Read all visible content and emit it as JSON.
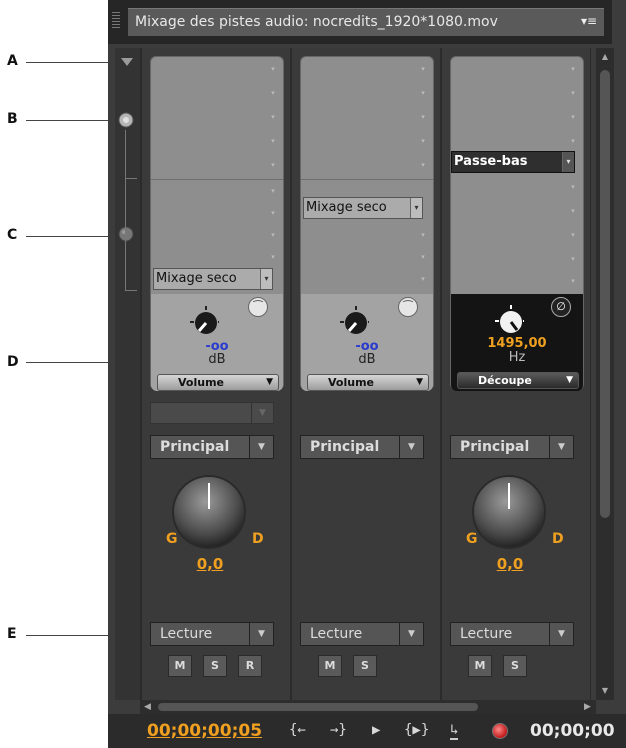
{
  "callouts": [
    "A",
    "B",
    "C",
    "D",
    "E"
  ],
  "panel": {
    "title": "Mixage des pistes audio: nocredits_1920*1080.mov",
    "menu_icon": "▾≡"
  },
  "channels": [
    {
      "effect_dropdown": "Mixage seco",
      "knob_value": "-oo",
      "knob_unit": "dB",
      "param": "Volume",
      "bypass_icon": "bypass-curl-icon",
      "route": "Principal",
      "pan_left": "G",
      "pan_right": "D",
      "pan_value": "0,0",
      "playback": "Lecture",
      "buttons": [
        "M",
        "S",
        "R"
      ]
    },
    {
      "effect_dropdown": "Mixage seco",
      "knob_value": "-oo",
      "knob_unit": "dB",
      "param": "Volume",
      "bypass_icon": "bypass-curl-icon",
      "route": "Principal",
      "playback": "Lecture",
      "buttons": [
        "M",
        "S"
      ]
    },
    {
      "effect_dropdown": "Passe-bas",
      "knob_value": "1495,00",
      "knob_unit": "Hz",
      "param": "Découpe",
      "bypass_icon": "bypass-off-icon",
      "route": "Principal",
      "pan_left": "G",
      "pan_right": "D",
      "pan_value": "0,0",
      "playback": "Lecture",
      "buttons": [
        "M",
        "S"
      ]
    }
  ],
  "transport": {
    "current_time": "00;00;00;05",
    "duration": "00;00;00",
    "buttons": {
      "go_in": "{←",
      "go_out": "→}",
      "play": "▶",
      "play_in_out": "{▶}",
      "loop": "↳",
      "record": "record-icon"
    }
  },
  "colors": {
    "accent_orange": "#f0a020",
    "value_blue": "#2a3ccf",
    "panel_bg": "#3c3c3c"
  }
}
